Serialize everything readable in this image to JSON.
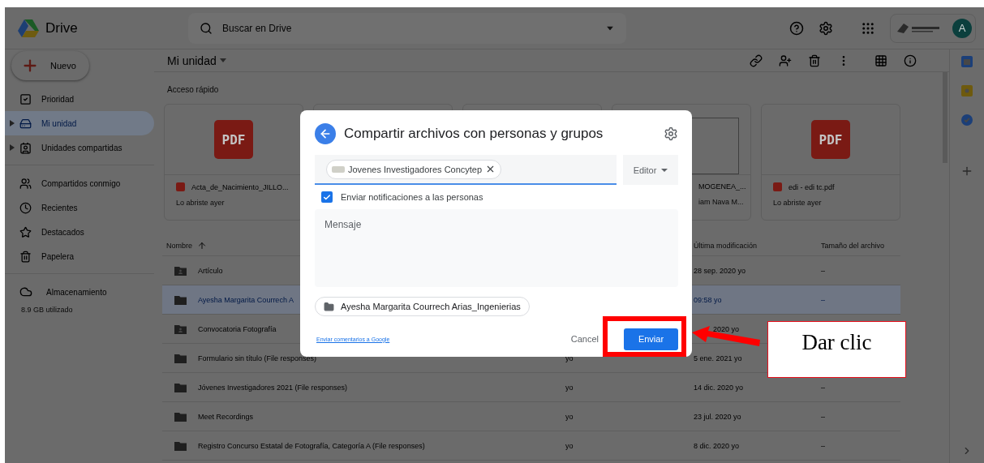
{
  "header": {
    "app_name": "Drive",
    "search": {
      "placeholder": "Buscar en Drive"
    },
    "avatar": "A"
  },
  "sidebar": {
    "new_button": "Nuevo",
    "groups": [
      {
        "items": [
          {
            "label": "Prioridad",
            "selected": false,
            "expandable": false
          },
          {
            "label": "Mi unidad",
            "selected": true,
            "expandable": true
          },
          {
            "label": "Unidades compartidas",
            "selected": false,
            "expandable": true
          }
        ]
      },
      {
        "items": [
          {
            "label": "Compartidos conmigo",
            "selected": false,
            "expandable": false
          },
          {
            "label": "Recientes",
            "selected": false,
            "expandable": false
          },
          {
            "label": "Destacados",
            "selected": false,
            "expandable": false
          },
          {
            "label": "Papelera",
            "selected": false,
            "expandable": false
          }
        ]
      }
    ],
    "storage": {
      "label": "Almacenamiento",
      "usage": "8.9 GB utilizado"
    }
  },
  "toolbar": {
    "title": "Mi unidad"
  },
  "quick_access": {
    "title": "Acceso rápido",
    "cards": [
      {
        "kind": "pdf",
        "badge": "PDF",
        "title": "Acta_de_Nacimiento_JILLO...",
        "subtitle": "Lo abriste ayer"
      },
      {
        "kind": "blank"
      },
      {
        "kind": "blank"
      },
      {
        "kind": "doc",
        "title": "MOGENEA_...",
        "subtitle": "iam Nava M..."
      },
      {
        "kind": "pdf",
        "badge": "PDF",
        "title": "edi - edi tc.pdf",
        "subtitle": "Lo abriste ayer"
      }
    ]
  },
  "table": {
    "columns": [
      "Nombre",
      "Última modificación",
      "Tamaño del archivo"
    ],
    "rows": [
      {
        "kind": "shared-folder",
        "name": "Artículo",
        "selected": false,
        "modified": "28 sep. 2020 yo",
        "size": "–"
      },
      {
        "kind": "folder",
        "name": "Ayesha Margarita Courrech A",
        "selected": true,
        "modified": "09:58 yo",
        "size": "–"
      },
      {
        "kind": "shared-folder",
        "name": "Convocatoria Fotografía",
        "selected": false,
        "modified": "2020 yo"
      },
      {
        "kind": "folder",
        "name": "Formulario sin título (File responses)",
        "selected": false,
        "owner": "yo",
        "modified": "5 ene. 2021 yo"
      },
      {
        "kind": "folder",
        "name": "Jóvenes Investigadores 2021 (File responses)",
        "selected": false,
        "owner": "yo",
        "modified": "14 dic. 2020 yo",
        "size": "–"
      },
      {
        "kind": "folder",
        "name": "Meet Recordings",
        "selected": false,
        "owner": "yo",
        "modified": "23 jul. 2020 yo",
        "size": "–"
      },
      {
        "kind": "folder",
        "name": "Registro Concurso Estatal de Fotografía, Categoría A (File responses)",
        "selected": false,
        "owner": "yo",
        "modified": "8 dic. 2020 yo",
        "size": "–"
      }
    ]
  },
  "dialog": {
    "title": "Compartir archivos con personas y grupos",
    "recipient": "Jovenes Investigadores Concytep",
    "role": "Editor",
    "notify": {
      "label": "Enviar notificaciones a las personas",
      "checked": true
    },
    "message": {
      "placeholder": "Mensaje"
    },
    "item": "Ayesha Margarita Courrech Arias_Ingenierias",
    "feedback_link": "Enviar comentarios a Google",
    "cancel": "Cancel",
    "send": "Enviar"
  },
  "annotation": {
    "text": "Dar clic"
  }
}
